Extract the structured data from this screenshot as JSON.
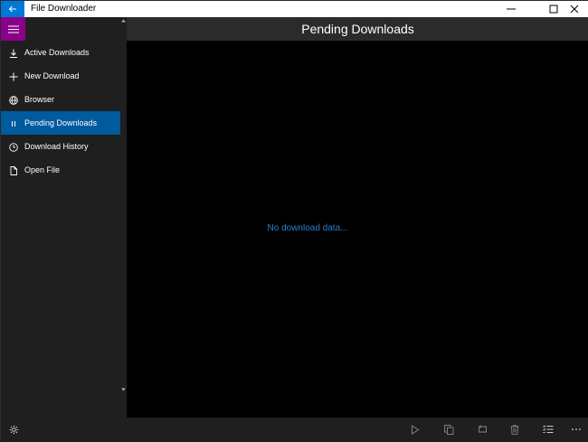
{
  "window": {
    "title": "File Downloader"
  },
  "header": {
    "title": "Pending Downloads"
  },
  "sidebar": {
    "items": [
      {
        "label": "Active Downloads",
        "icon": "download-icon",
        "active": false
      },
      {
        "label": "New Download",
        "icon": "plus-icon",
        "active": false
      },
      {
        "label": "Browser",
        "icon": "globe-icon",
        "active": false
      },
      {
        "label": "Pending Downloads",
        "icon": "pause-icon",
        "active": true
      },
      {
        "label": "Download History",
        "icon": "clock-icon",
        "active": false
      },
      {
        "label": "Open File",
        "icon": "file-icon",
        "active": false
      }
    ]
  },
  "content": {
    "empty_message": "No download data..."
  },
  "command_bar": {
    "icons": [
      "settings-icon",
      "play-icon",
      "copy-icon",
      "loop-icon",
      "trash-icon",
      "checklist-icon",
      "more-icon"
    ]
  },
  "colors": {
    "accent_blue": "#0078d7",
    "active_item": "#005a9e",
    "hamburger": "#8b008b",
    "message": "#2f7fd0"
  }
}
